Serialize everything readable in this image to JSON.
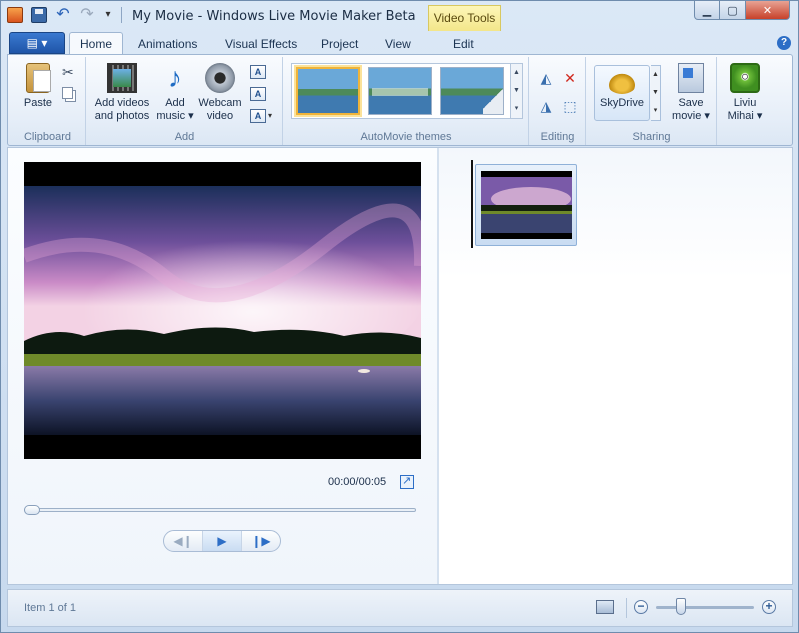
{
  "titlebar": {
    "title": "My Movie - Windows Live Movie Maker Beta",
    "contextual_tab_group": "Video Tools"
  },
  "tabs": [
    {
      "label": "Home",
      "active": true
    },
    {
      "label": "Animations",
      "active": false
    },
    {
      "label": "Visual Effects",
      "active": false
    },
    {
      "label": "Project",
      "active": false
    },
    {
      "label": "View",
      "active": false
    },
    {
      "label": "Edit",
      "active": false
    }
  ],
  "ribbon": {
    "clipboard": {
      "group_label": "Clipboard",
      "paste_label": "Paste"
    },
    "add": {
      "group_label": "Add",
      "add_videos_line1": "Add videos",
      "add_videos_line2": "and photos",
      "add_music_line1": "Add",
      "add_music_line2": "music ▾",
      "webcam_line1": "Webcam",
      "webcam_line2": "video"
    },
    "automovie": {
      "group_label": "AutoMovie themes"
    },
    "editing": {
      "group_label": "Editing"
    },
    "sharing": {
      "group_label": "Sharing",
      "skydrive_label": "SkyDrive",
      "save_movie_line1": "Save",
      "save_movie_line2": "movie ▾"
    },
    "account": {
      "name_line1": "Liviu",
      "name_line2": "Mihai ▾"
    }
  },
  "preview": {
    "timecode": "00:00/00:05",
    "seek_position": 0
  },
  "status": {
    "item_text": "Item 1 of 1",
    "zoom_level": 0.25
  },
  "colors": {
    "contextual_tab": "#f3e68a",
    "file_button": "#1f55a8",
    "selected_theme_border": "#f0b43a",
    "play_accent": "#2d6ec6"
  }
}
